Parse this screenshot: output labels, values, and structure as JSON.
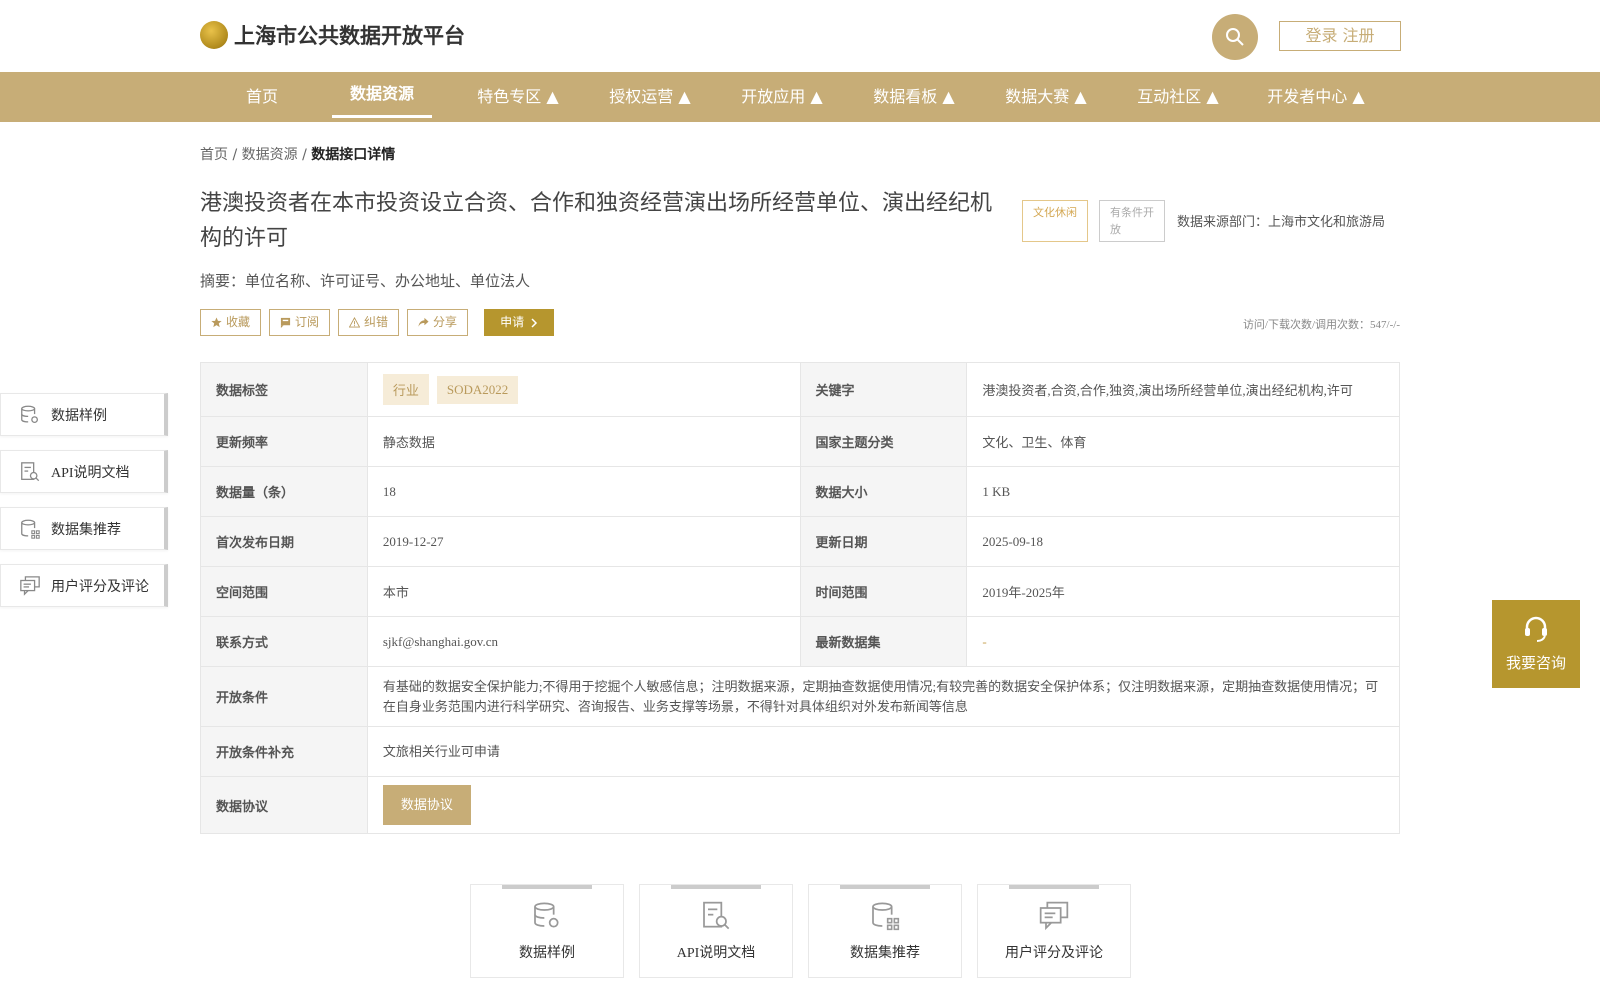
{
  "header": {
    "site_title": "上海市公共数据开放平台",
    "login_label": "登录 注册",
    "icons": {
      "logo": "city-emblem-icon",
      "search": "search-icon"
    }
  },
  "nav": {
    "items": [
      {
        "label": "首页"
      },
      {
        "label": "数据资源"
      },
      {
        "label": "特色专区 ▲"
      },
      {
        "label": "授权运营 ▲"
      },
      {
        "label": "开放应用 ▲"
      },
      {
        "label": "数据看板 ▲"
      },
      {
        "label": "数据大赛 ▲"
      },
      {
        "label": "互动社区 ▲"
      },
      {
        "label": "开发者中心 ▲"
      }
    ],
    "active": "数据资源"
  },
  "breadcrumb": {
    "home": "首页",
    "sep1": "/",
    "resources": "数据资源",
    "sep2": "/",
    "current": "数据接口详情"
  },
  "dataset": {
    "title": "港澳投资者在本市投资设立合资、合作和独资经营演出场所经营单位、演出经纪机构的许可",
    "tag_category": "文化休闲",
    "tag_open": "有条件开放",
    "source": "数据来源部门：上海市文化和旅游局",
    "summary": "摘要：单位名称、许可证号、办公地址、单位法人"
  },
  "actions": {
    "favorite": "收藏",
    "subscribe": "订阅",
    "report": "纠错",
    "share": "分享",
    "apply": "申请",
    "stats": "访问/下载次数/调用次数：547/-/-"
  },
  "info": {
    "labels": {
      "tags": "数据标签",
      "keywords": "关键字",
      "frequency": "更新频率",
      "theme": "国家主题分类",
      "count": "数据量（条）",
      "size": "数据大小",
      "first_release": "首次发布日期",
      "update_date": "更新日期",
      "space": "空间范围",
      "time": "时间范围",
      "contact": "联系方式",
      "latest": "最新数据集",
      "conditions": "开放条件",
      "conditions_extra": "开放条件补充",
      "agreement": "数据协议"
    },
    "tag_chips": [
      "行业",
      "SODA2022"
    ],
    "keywords": "港澳投资者,合资,合作,独资,演出场所经营单位,演出经纪机构,许可",
    "frequency": "静态数据",
    "theme": "文化、卫生、体育",
    "count": "18",
    "size": "1 KB",
    "first_release": "2019-12-27",
    "update_date": "2025-09-18",
    "space": "本市",
    "time": "2019年-2025年",
    "contact": "sjkf@shanghai.gov.cn",
    "latest": "-",
    "conditions": "有基础的数据安全保护能力;不得用于挖掘个人敏感信息；注明数据来源，定期抽查数据使用情况;有较完善的数据安全保护体系；仅注明数据来源，定期抽查数据使用情况；可在自身业务范围内进行科学研究、咨询报告、业务支撑等场景，不得针对具体组织对外发布新闻等信息",
    "conditions_extra": "文旅相关行业可申请",
    "agreement_button": "数据协议"
  },
  "side_menu": [
    {
      "label": "数据样例",
      "icon": "database-settings-icon"
    },
    {
      "label": "API说明文档",
      "icon": "document-search-icon"
    },
    {
      "label": "数据集推荐",
      "icon": "database-grid-icon"
    },
    {
      "label": "用户评分及评论",
      "icon": "comment-icon"
    }
  ],
  "consult": {
    "label": "我要咨询",
    "icon": "headset-icon"
  },
  "bottom_tabs": [
    {
      "label": "数据样例",
      "icon": "database-settings-icon"
    },
    {
      "label": "API说明文档",
      "icon": "document-search-icon"
    },
    {
      "label": "数据集推荐",
      "icon": "database-grid-icon"
    },
    {
      "label": "用户评分及评论",
      "icon": "comment-icon"
    }
  ],
  "colors": {
    "brand": "#c7ad77",
    "accent": "#b6962e"
  }
}
